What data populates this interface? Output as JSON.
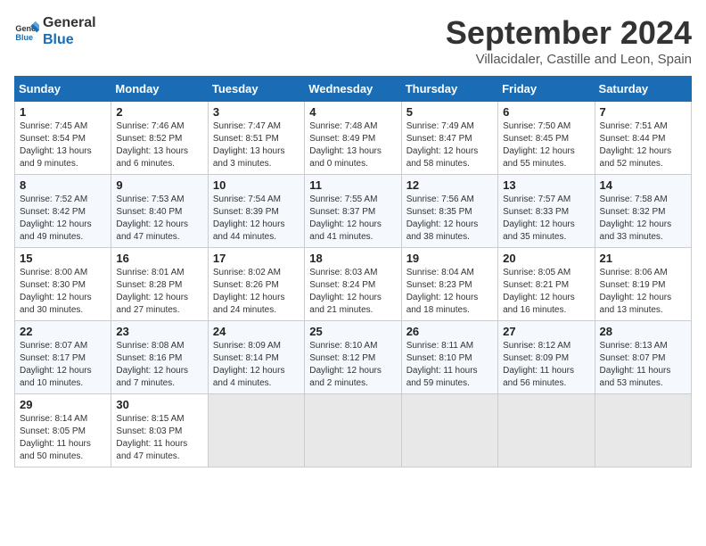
{
  "logo": {
    "line1": "General",
    "line2": "Blue"
  },
  "title": {
    "month_year": "September 2024",
    "subtitle": "Villacidaler, Castille and Leon, Spain"
  },
  "calendar": {
    "headers": [
      "Sunday",
      "Monday",
      "Tuesday",
      "Wednesday",
      "Thursday",
      "Friday",
      "Saturday"
    ],
    "weeks": [
      [
        {
          "day": "1",
          "sunrise": "7:45 AM",
          "sunset": "8:54 PM",
          "daylight": "13 hours and 9 minutes."
        },
        {
          "day": "2",
          "sunrise": "7:46 AM",
          "sunset": "8:52 PM",
          "daylight": "13 hours and 6 minutes."
        },
        {
          "day": "3",
          "sunrise": "7:47 AM",
          "sunset": "8:51 PM",
          "daylight": "13 hours and 3 minutes."
        },
        {
          "day": "4",
          "sunrise": "7:48 AM",
          "sunset": "8:49 PM",
          "daylight": "13 hours and 0 minutes."
        },
        {
          "day": "5",
          "sunrise": "7:49 AM",
          "sunset": "8:47 PM",
          "daylight": "12 hours and 58 minutes."
        },
        {
          "day": "6",
          "sunrise": "7:50 AM",
          "sunset": "8:45 PM",
          "daylight": "12 hours and 55 minutes."
        },
        {
          "day": "7",
          "sunrise": "7:51 AM",
          "sunset": "8:44 PM",
          "daylight": "12 hours and 52 minutes."
        }
      ],
      [
        {
          "day": "8",
          "sunrise": "7:52 AM",
          "sunset": "8:42 PM",
          "daylight": "12 hours and 49 minutes."
        },
        {
          "day": "9",
          "sunrise": "7:53 AM",
          "sunset": "8:40 PM",
          "daylight": "12 hours and 47 minutes."
        },
        {
          "day": "10",
          "sunrise": "7:54 AM",
          "sunset": "8:39 PM",
          "daylight": "12 hours and 44 minutes."
        },
        {
          "day": "11",
          "sunrise": "7:55 AM",
          "sunset": "8:37 PM",
          "daylight": "12 hours and 41 minutes."
        },
        {
          "day": "12",
          "sunrise": "7:56 AM",
          "sunset": "8:35 PM",
          "daylight": "12 hours and 38 minutes."
        },
        {
          "day": "13",
          "sunrise": "7:57 AM",
          "sunset": "8:33 PM",
          "daylight": "12 hours and 35 minutes."
        },
        {
          "day": "14",
          "sunrise": "7:58 AM",
          "sunset": "8:32 PM",
          "daylight": "12 hours and 33 minutes."
        }
      ],
      [
        {
          "day": "15",
          "sunrise": "8:00 AM",
          "sunset": "8:30 PM",
          "daylight": "12 hours and 30 minutes."
        },
        {
          "day": "16",
          "sunrise": "8:01 AM",
          "sunset": "8:28 PM",
          "daylight": "12 hours and 27 minutes."
        },
        {
          "day": "17",
          "sunrise": "8:02 AM",
          "sunset": "8:26 PM",
          "daylight": "12 hours and 24 minutes."
        },
        {
          "day": "18",
          "sunrise": "8:03 AM",
          "sunset": "8:24 PM",
          "daylight": "12 hours and 21 minutes."
        },
        {
          "day": "19",
          "sunrise": "8:04 AM",
          "sunset": "8:23 PM",
          "daylight": "12 hours and 18 minutes."
        },
        {
          "day": "20",
          "sunrise": "8:05 AM",
          "sunset": "8:21 PM",
          "daylight": "12 hours and 16 minutes."
        },
        {
          "day": "21",
          "sunrise": "8:06 AM",
          "sunset": "8:19 PM",
          "daylight": "12 hours and 13 minutes."
        }
      ],
      [
        {
          "day": "22",
          "sunrise": "8:07 AM",
          "sunset": "8:17 PM",
          "daylight": "12 hours and 10 minutes."
        },
        {
          "day": "23",
          "sunrise": "8:08 AM",
          "sunset": "8:16 PM",
          "daylight": "12 hours and 7 minutes."
        },
        {
          "day": "24",
          "sunrise": "8:09 AM",
          "sunset": "8:14 PM",
          "daylight": "12 hours and 4 minutes."
        },
        {
          "day": "25",
          "sunrise": "8:10 AM",
          "sunset": "8:12 PM",
          "daylight": "12 hours and 2 minutes."
        },
        {
          "day": "26",
          "sunrise": "8:11 AM",
          "sunset": "8:10 PM",
          "daylight": "11 hours and 59 minutes."
        },
        {
          "day": "27",
          "sunrise": "8:12 AM",
          "sunset": "8:09 PM",
          "daylight": "11 hours and 56 minutes."
        },
        {
          "day": "28",
          "sunrise": "8:13 AM",
          "sunset": "8:07 PM",
          "daylight": "11 hours and 53 minutes."
        }
      ],
      [
        {
          "day": "29",
          "sunrise": "8:14 AM",
          "sunset": "8:05 PM",
          "daylight": "11 hours and 50 minutes."
        },
        {
          "day": "30",
          "sunrise": "8:15 AM",
          "sunset": "8:03 PM",
          "daylight": "11 hours and 47 minutes."
        },
        null,
        null,
        null,
        null,
        null
      ]
    ]
  }
}
